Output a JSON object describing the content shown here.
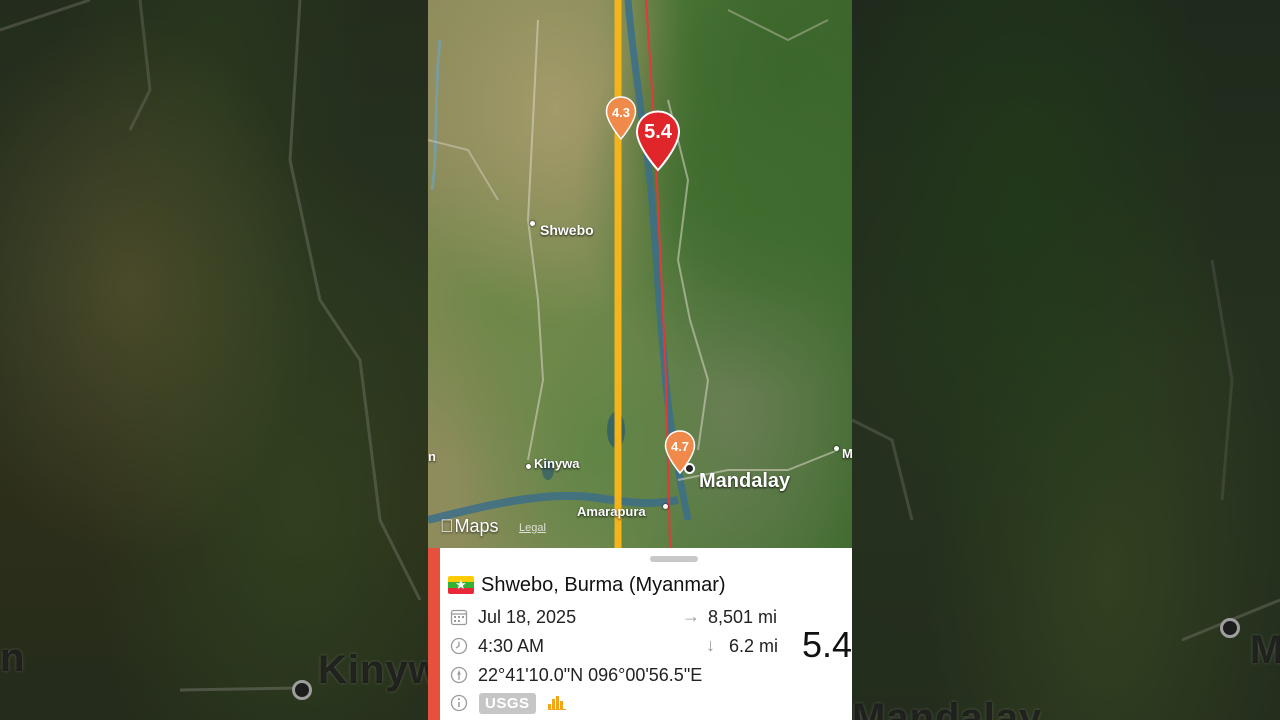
{
  "background": {
    "left_label": "Kinyw",
    "left_label_edge": "n",
    "right_label": "M",
    "bottom_label": "Mandalay"
  },
  "map": {
    "places": {
      "shwebo": "Shwebo",
      "kinywa": "Kinywa",
      "mandalay": "Mandalay",
      "amarapura": "Amarapura",
      "edge_left": "n",
      "edge_right": "M"
    },
    "pins": [
      {
        "magnitude": "4.3",
        "color": "#f08a4b"
      },
      {
        "magnitude": "5.4",
        "color": "#e0262a"
      },
      {
        "magnitude": "4.7",
        "color": "#f08a4b"
      }
    ],
    "attribution": {
      "brand": "Maps",
      "legal": "Legal"
    },
    "colors": {
      "path_yellow": "#f4b41a",
      "path_red": "#e03a3a"
    }
  },
  "sheet": {
    "accent_color": "#e5513d",
    "location": "Shwebo, Burma (Myanmar)",
    "country_flag": "myanmar-flag",
    "date": "Jul 18, 2025",
    "time": "4:30 AM",
    "distance": "8,501 mi",
    "depth": "6.2 mi",
    "coordinates": "22°41'10.0\"N 096°00'56.5\"E",
    "magnitude": "5.4",
    "source": "USGS",
    "icons": {
      "date": "calendar-icon",
      "time": "clock-icon",
      "coords": "location-icon",
      "info": "info-icon",
      "distance": "arrow-right-icon",
      "depth": "arrow-down-icon",
      "intensity": "bar-chart-icon"
    }
  }
}
